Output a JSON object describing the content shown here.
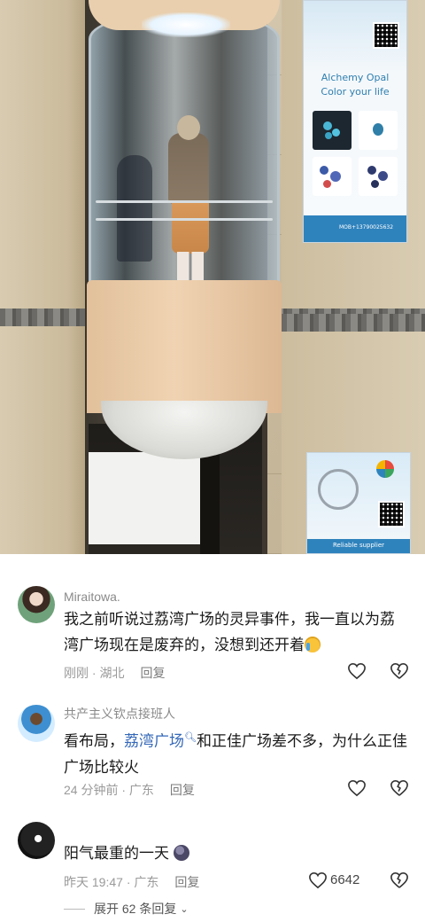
{
  "photo": {
    "ad_top_line1": "Alchemy Opal",
    "ad_top_line2": "Color your life",
    "ad_top_footer": "MOB+13790025632",
    "ad_bottom_footer": "Reliable supplier"
  },
  "comments": [
    {
      "username": "Miraitowa.",
      "text": "我之前听说过荔湾广场的灵异事件，我一直以为荔湾广场现在是废弃的，没想到还开着",
      "emoji": "crying-face",
      "time": "刚刚",
      "location": "湖北",
      "reply_label": "回复",
      "likes": ""
    },
    {
      "username": "共产主义钦点接班人",
      "text_prefix": "看布局，",
      "link": "荔湾广场",
      "text_suffix": "和正佳广场差不多，为什么正佳广场比较火",
      "time": "24 分钟前",
      "location": "广东",
      "reply_label": "回复",
      "likes": ""
    },
    {
      "username": "",
      "text": "阳气最重的一天",
      "emoji": "dark-blob",
      "time": "昨天 19:47",
      "location": "广东",
      "reply_label": "回复",
      "likes": "6642"
    }
  ],
  "expand_replies": "展开 62 条回复",
  "icons": {
    "like": "heart-outline-icon",
    "dislike": "broken-heart-icon",
    "expand": "chevron-down-icon",
    "search": "search-icon"
  },
  "colors": {
    "link": "#3468b8",
    "meta": "#9a9a9a",
    "ad_blue": "#2f83bd"
  }
}
